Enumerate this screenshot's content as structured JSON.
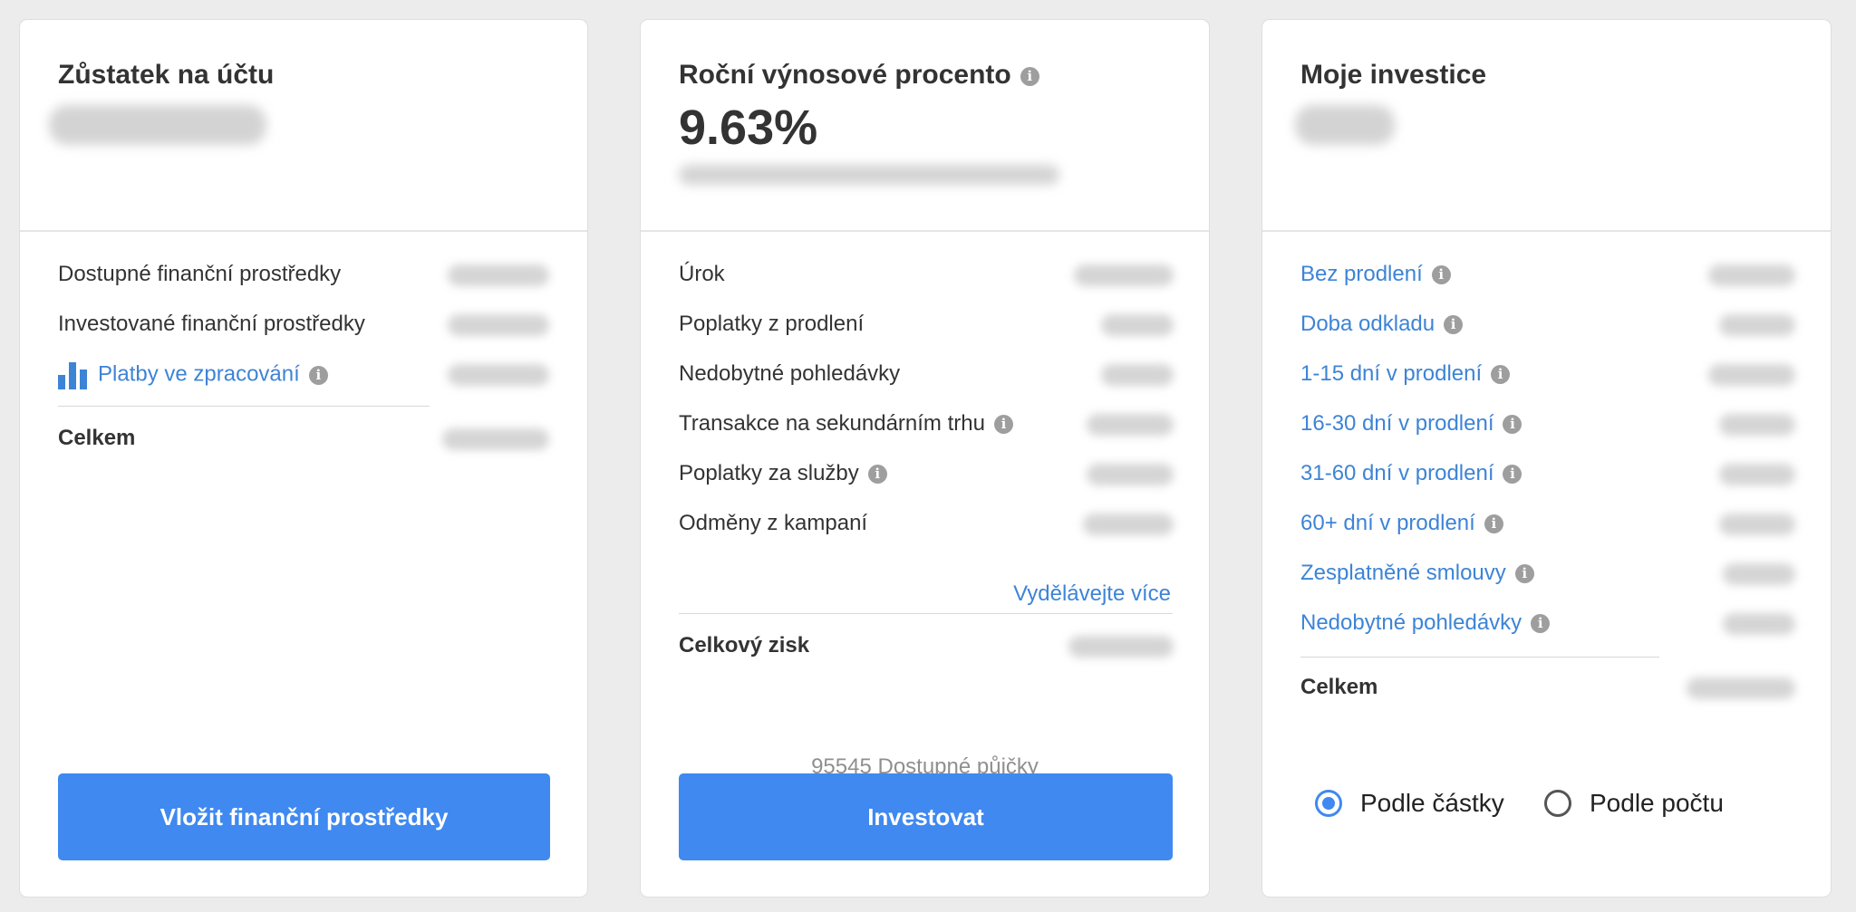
{
  "balance_card": {
    "title": "Zůstatek na účtu",
    "rows": [
      {
        "label": "Dostupné finanční prostředky"
      },
      {
        "label": "Investované finanční prostředky"
      },
      {
        "label": "Platby ve zpracování"
      }
    ],
    "total_label": "Celkem",
    "button_label": "Vložit finanční prostředky"
  },
  "yield_card": {
    "title": "Roční výnosové procento",
    "value": "9.63%",
    "rows": [
      {
        "label": "Úrok"
      },
      {
        "label": "Poplatky z prodlení"
      },
      {
        "label": "Nedobytné pohledávky"
      },
      {
        "label": "Transakce na sekundárním trhu"
      },
      {
        "label": "Poplatky za služby"
      },
      {
        "label": "Odměny z kampaní"
      }
    ],
    "earn_more_link": "Vydělávejte více",
    "total_label": "Celkový zisk",
    "available_loans": "95545 Dostupné půjčky",
    "button_label": "Investovat"
  },
  "investments_card": {
    "title": "Moje investice",
    "rows": [
      {
        "label": "Bez prodlení"
      },
      {
        "label": "Doba odkladu"
      },
      {
        "label": "1-15 dní v prodlení"
      },
      {
        "label": "16-30 dní v prodlení"
      },
      {
        "label": "31-60 dní v prodlení"
      },
      {
        "label": "60+ dní v prodlení"
      },
      {
        "label": "Zesplatněné smlouvy"
      },
      {
        "label": "Nedobytné pohledávky"
      }
    ],
    "total_label": "Celkem",
    "radio_options": [
      {
        "label": "Podle částky",
        "selected": true
      },
      {
        "label": "Podle počtu",
        "selected": false
      }
    ]
  },
  "colors": {
    "accent": "#3f89f0",
    "link": "#3d84d6",
    "background": "#ececec"
  },
  "icons": {
    "info": "info-icon",
    "bar_chart": "bar-chart-icon"
  }
}
